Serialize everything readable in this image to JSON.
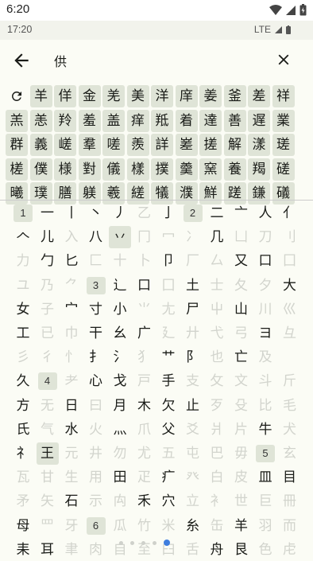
{
  "status": {
    "time": "6:20"
  },
  "sub_status": {
    "time": "17:20",
    "network": "LTE"
  },
  "search": {
    "query": "供"
  },
  "results": [
    [
      "羊",
      "佯",
      "金",
      "羌",
      "美",
      "洋",
      "庠",
      "姜",
      "釜",
      "差",
      "祥"
    ],
    [
      "羔",
      "恙",
      "羚",
      "羞",
      "盖",
      "痒",
      "羝",
      "着",
      "達",
      "善",
      "遅",
      "業"
    ],
    [
      "群",
      "義",
      "嵯",
      "羣",
      "嗟",
      "羨",
      "詳",
      "嵳",
      "搓",
      "解",
      "漾",
      "瑳"
    ],
    [
      "槎",
      "僕",
      "様",
      "對",
      "儀",
      "樣",
      "撲",
      "羹",
      "窯",
      "養",
      "羯",
      "磋"
    ],
    [
      "曦",
      "璞",
      "膳",
      "躾",
      "羲",
      "縒",
      "犠",
      "濮",
      "鮮",
      "蹉",
      "鎌",
      "礒"
    ]
  ],
  "radicals": [
    [
      "1",
      "一",
      "丨",
      "丶",
      "丿",
      "乙",
      "亅",
      "2",
      "二",
      "亠",
      "人",
      "亻"
    ],
    [
      "𠆢",
      "儿",
      "入",
      "八",
      "丷",
      "冂",
      "冖",
      "冫",
      "几",
      "凵",
      "刀",
      "刂"
    ],
    [
      "力",
      "勹",
      "匕",
      "匚",
      "十",
      "卜",
      "卩",
      "厂",
      "厶",
      "又",
      "口",
      "囗"
    ],
    [
      "ユ",
      "乃",
      "⺈",
      "3",
      "辶",
      "口",
      "囗",
      "土",
      "士",
      "夂",
      "夕",
      "大"
    ],
    [
      "女",
      "子",
      "宀",
      "寸",
      "小",
      "⺌",
      "尢",
      "尸",
      "屮",
      "山",
      "川",
      "巛"
    ],
    [
      "工",
      "已",
      "巾",
      "干",
      "幺",
      "广",
      "廴",
      "廾",
      "弋",
      "弓",
      "ヨ",
      "彑"
    ],
    [
      "彡",
      "彳",
      "忄",
      "扌",
      "氵",
      "犭",
      "艹",
      "阝",
      "也",
      "亡",
      "及"
    ],
    [
      "久",
      "4",
      "耂",
      "心",
      "戈",
      "戸",
      "手",
      "支",
      "攵",
      "文",
      "斗",
      "斤"
    ],
    [
      "方",
      "无",
      "日",
      "曰",
      "月",
      "木",
      "欠",
      "止",
      "歹",
      "殳",
      "比",
      "毛"
    ],
    [
      "氏",
      "气",
      "水",
      "火",
      "灬",
      "爪",
      "父",
      "爻",
      "爿",
      "片",
      "牛",
      "犬"
    ],
    [
      "礻",
      "王",
      "元",
      "井",
      "勿",
      "尤",
      "五",
      "屯",
      "巴",
      "毋",
      "5",
      "玄"
    ],
    [
      "瓦",
      "甘",
      "生",
      "用",
      "田",
      "疋",
      "疒",
      "癶",
      "白",
      "皮",
      "皿",
      "目"
    ],
    [
      "矛",
      "矢",
      "石",
      "示",
      "禸",
      "禾",
      "穴",
      "立",
      "衤",
      "世",
      "巨",
      "冊"
    ],
    [
      "母",
      "罒",
      "牙",
      "6",
      "瓜",
      "竹",
      "米",
      "糸",
      "缶",
      "羊",
      "羽",
      "而"
    ],
    [
      "耒",
      "耳",
      "聿",
      "肉",
      "自",
      "至",
      "臼",
      "舌",
      "舟",
      "艮",
      "色",
      "虍"
    ]
  ],
  "icons": {
    "back": "arrow-left-icon",
    "clear": "close-icon",
    "refresh": "refresh-icon"
  },
  "colors": {
    "accent": "#3f7ede",
    "chip": "#dfe4d7",
    "background": "#fbfcf5"
  },
  "pager": {
    "pages": 5,
    "current": 5
  }
}
